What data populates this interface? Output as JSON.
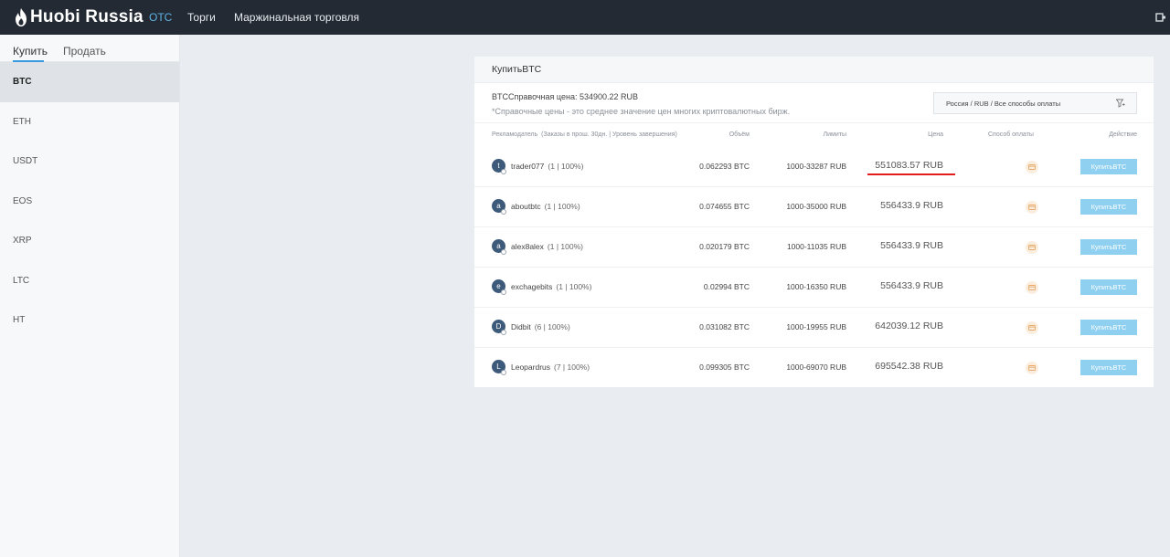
{
  "app": {
    "logo_text": "Huobi Russia"
  },
  "nav": {
    "items": [
      {
        "label": "OTC",
        "active": true
      },
      {
        "label": "Торги",
        "active": false
      },
      {
        "label": "Маржинальная торговля",
        "active": false
      }
    ]
  },
  "sidebar": {
    "tabs": [
      {
        "label": "Купить",
        "active": true
      },
      {
        "label": "Продать",
        "active": false
      }
    ],
    "coins": [
      "BTC",
      "ETH",
      "USDT",
      "EOS",
      "XRP",
      "LTC",
      "HT"
    ],
    "selected_coin": "BTC"
  },
  "main": {
    "title": "КупитьBTC",
    "reference_label": "BTCСправочная цена:",
    "reference_price": "534900.22 RUB",
    "reference_note": "*Справочные цены - это среднее значение цен многих криптовалютных бирж.",
    "filter_text": "Россия / RUB / Все способы оплаты",
    "columns": {
      "advertiser": "Рекламодатель",
      "advertiser_hint": "(Заказы в прош. 30дн. | Уровень завершения)",
      "volume": "Объём",
      "limits": "Лимиты",
      "price": "Цена",
      "payment": "Способ оплаты",
      "action": "Действие"
    },
    "rows": [
      {
        "initial": "t",
        "name": "trader077",
        "stats": "(1 | 100%)",
        "volume": "0.062293 BTC",
        "limits": "1000-33287 RUB",
        "price": "551083.57 RUB",
        "action": "КупитьBTC"
      },
      {
        "initial": "a",
        "name": "aboutbtc",
        "stats": "(1 | 100%)",
        "volume": "0.074655 BTC",
        "limits": "1000-35000 RUB",
        "price": "556433.9 RUB",
        "action": "КупитьBTC"
      },
      {
        "initial": "a",
        "name": "alex8alex",
        "stats": "(1 | 100%)",
        "volume": "0.020179 BTC",
        "limits": "1000-11035 RUB",
        "price": "556433.9 RUB",
        "action": "КупитьBTC"
      },
      {
        "initial": "e",
        "name": "exchagebits",
        "stats": "(1 | 100%)",
        "volume": "0.02994 BTC",
        "limits": "1000-16350 RUB",
        "price": "556433.9 RUB",
        "action": "КупитьBTC"
      },
      {
        "initial": "D",
        "name": "Didbit",
        "stats": "(6 | 100%)",
        "volume": "0.031082 BTC",
        "limits": "1000-19955 RUB",
        "price": "642039.12 RUB",
        "action": "КупитьBTC"
      },
      {
        "initial": "L",
        "name": "Leopardrus",
        "stats": "(7 | 100%)",
        "volume": "0.099305 BTC",
        "limits": "1000-69070 RUB",
        "price": "695542.38 RUB",
        "action": "КупитьBTC"
      }
    ]
  },
  "colors": {
    "topbar": "#232a33",
    "accent": "#3a9ae0",
    "buy_button": "#8fd0f1",
    "highlight_underline": "#e21d1d"
  }
}
